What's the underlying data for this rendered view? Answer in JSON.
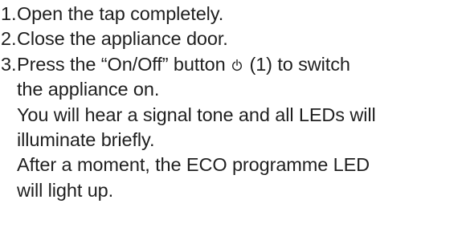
{
  "steps": [
    {
      "number": "1.",
      "text": "Open the tap completely."
    },
    {
      "number": "2.",
      "text": "Close the appliance door."
    },
    {
      "number": "3.",
      "text_before_icon": "Press the “On/Off” button",
      "icon": "power-icon",
      "text_after_icon": "(1) to switch",
      "text_cont": "the appliance on.",
      "notes": [
        {
          "line1": "You will hear a signal tone and all LEDs will",
          "line2": "illuminate briefly."
        },
        {
          "line1": "After a moment, the ECO programme LED",
          "line2": "will light up."
        }
      ]
    }
  ]
}
